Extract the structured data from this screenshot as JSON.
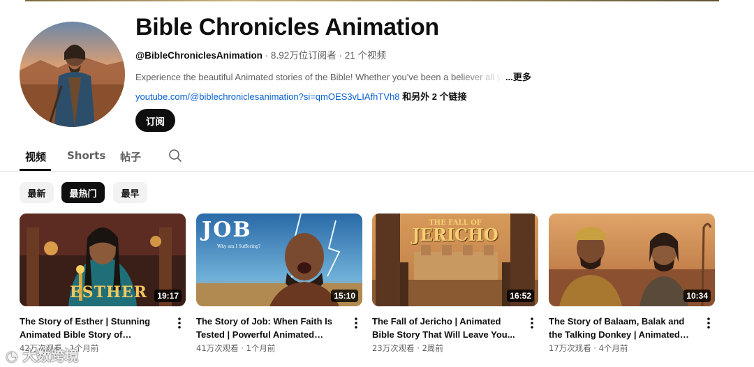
{
  "channel": {
    "title": "Bible Chronicles Animation",
    "handle": "@BibleChroniclesAnimation",
    "subscribers": " · 8.92万位订阅者",
    "video_count": " · 21 个视频",
    "description": "Experience the beautiful Animated stories of the Bible! Whether you've been a believer all your life",
    "more_label": "...更多",
    "link": "youtube.com/@biblechroniclesanimation?si=qmOES3vLIAfhTVh8",
    "link_more": " 和另外 2 个链接",
    "subscribe_label": "订阅"
  },
  "tabs": [
    {
      "label": "视频",
      "active": true
    },
    {
      "label": "Shorts",
      "active": false
    },
    {
      "label": "帖子",
      "active": false
    }
  ],
  "chips": [
    {
      "label": "最新",
      "active": false
    },
    {
      "label": "最热门",
      "active": true
    },
    {
      "label": "最早",
      "active": false
    }
  ],
  "videos": [
    {
      "title": "The Story of Esther | Stunning Animated Bible Story of Courage...",
      "duration": "19:17",
      "views": "42万次观看",
      "age": "1个月前",
      "thumb_text": "ESTHER"
    },
    {
      "title": "The Story of Job: When Faith Is Tested | Powerful Animated Bible...",
      "duration": "15:10",
      "views": "41万次观看",
      "age": "1个月前",
      "thumb_text": "JOB",
      "thumb_subtext": "Why am I Suffering?"
    },
    {
      "title": "The Fall of Jericho | Animated Bible Story That Will Leave You...",
      "duration": "16:52",
      "views": "23万次观看",
      "age": "2周前",
      "thumb_text_top": "THE FALL OF",
      "thumb_text": "JERICHO"
    },
    {
      "title": "The Story of Balaam, Balak and the Talking Donkey | Animated Bible...",
      "duration": "10:34",
      "views": "17万次观看",
      "age": "4个月前"
    }
  ],
  "watermark": "大数跨境",
  "colors": {
    "accent_link": "#065fd4",
    "text_primary": "#0f0f0f",
    "text_secondary": "#606060",
    "chip_bg": "#f2f2f2"
  },
  "icons": [
    "search-icon",
    "more-vert-icon"
  ]
}
